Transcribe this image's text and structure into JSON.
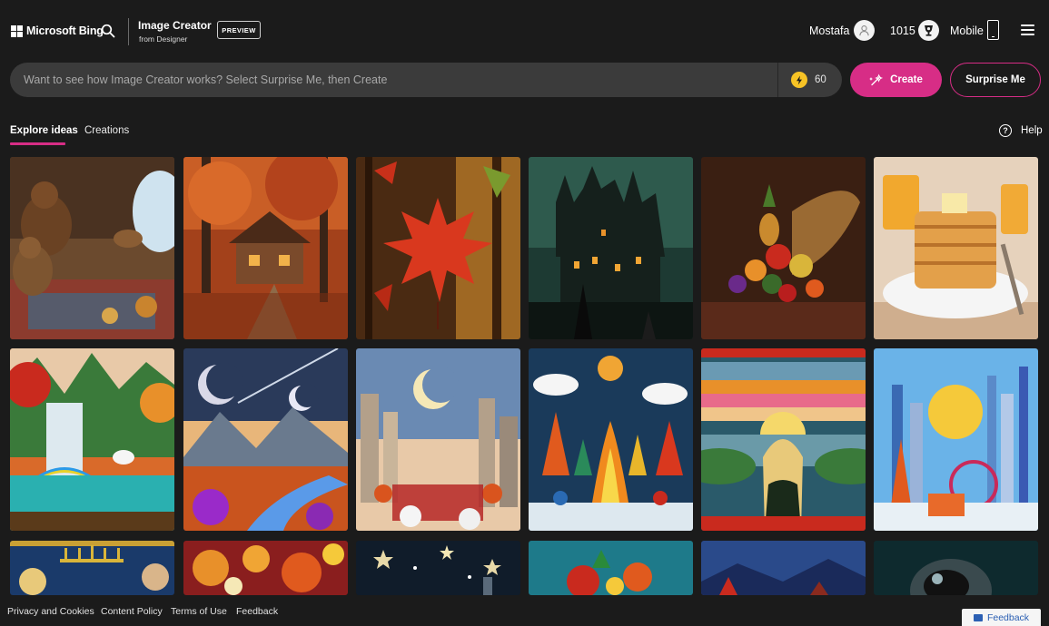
{
  "header": {
    "brand": "Microsoft Bing",
    "product_title": "Image Creator",
    "product_subtitle": "from Designer",
    "badge": "PREVIEW",
    "user_name": "Mostafa",
    "rewards_points": "1015",
    "mobile_label": "Mobile"
  },
  "prompt": {
    "placeholder": "Want to see how Image Creator works? Select Surprise Me, then Create",
    "boosts": "60",
    "create_label": "Create",
    "surprise_label": "Surprise Me"
  },
  "tabs": {
    "explore": "Explore ideas",
    "creations": "Creations",
    "help": "Help"
  },
  "footer": {
    "links": [
      "Privacy and Cookies",
      "Content Policy",
      "Terms of Use",
      "Feedback"
    ],
    "feedback_button": "Feedback"
  },
  "colors": {
    "accent": "#d72d86",
    "background": "#1b1b1b",
    "prompt_bg": "#3b3b3b",
    "boost_coin": "#f7c325"
  },
  "icons": [
    "windows-logo-icon",
    "search-icon",
    "user-icon",
    "rewards-icon",
    "mobile-icon",
    "menu-icon",
    "boost-icon",
    "create-icon",
    "help-icon",
    "feedback-icon"
  ],
  "gallery": [
    {
      "subject": "bear-den"
    },
    {
      "subject": "autumn-cabin"
    },
    {
      "subject": "maple-leaf"
    },
    {
      "subject": "haunted-castle"
    },
    {
      "subject": "cornucopia"
    },
    {
      "subject": "pancakes"
    },
    {
      "subject": "waterfall-unicorn"
    },
    {
      "subject": "planets-canyon"
    },
    {
      "subject": "moon-city"
    },
    {
      "subject": "felt-bonfire"
    },
    {
      "subject": "felt-woman-sunset"
    },
    {
      "subject": "paper-city"
    },
    {
      "subject": "menorah-art"
    },
    {
      "subject": "paper-lanterns"
    },
    {
      "subject": "starry-night"
    },
    {
      "subject": "festive-toys"
    },
    {
      "subject": "winter-village"
    },
    {
      "subject": "robot-helmet"
    }
  ]
}
